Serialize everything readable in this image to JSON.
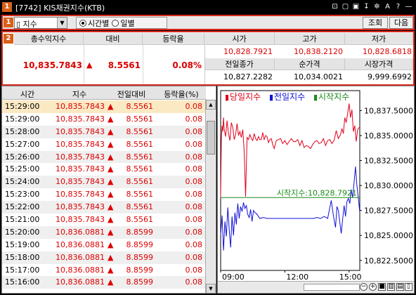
{
  "titlebar": {
    "badge": "1",
    "title": "[7742] KIS채권지수(KTB)",
    "controls": [
      "⊡",
      "▢",
      "▣",
      "↧",
      "✲",
      "A",
      "?",
      "—"
    ]
  },
  "toolbar": {
    "badge": "1",
    "select_value": "▯ 지수",
    "radio_time": "시간별",
    "radio_day": "일별",
    "query_button": "조회",
    "next_button": "다음"
  },
  "summary": {
    "badge": "2",
    "headers": {
      "total": "총수익지수",
      "change": "대비",
      "rate": "등락율",
      "high_open": "시가",
      "high": "고가",
      "low": "저가",
      "prev_close": "전일종가",
      "net_price": "순가격",
      "market_price": "시장가격"
    },
    "total_value": "10,835.7843",
    "change_arrow": "▲",
    "change_value": "8.5561",
    "rate_value": "0.08%",
    "open": "10,828.7921",
    "high": "10,838.2120",
    "low": "10,828.6818",
    "prev_close": "10,827.2282",
    "net_price": "10,034.0021",
    "market_price": "9,999.6992"
  },
  "table": {
    "columns": [
      "시간",
      "지수",
      "전일대비",
      "등락율(%)"
    ],
    "rows": [
      {
        "time": "15:29:00",
        "index": "10,835.7843",
        "arrow": "▲",
        "change": "8.5561",
        "rate": "0.08"
      },
      {
        "time": "15:29:00",
        "index": "10,835.7843",
        "arrow": "▲",
        "change": "8.5561",
        "rate": "0.08"
      },
      {
        "time": "15:28:00",
        "index": "10,835.7843",
        "arrow": "▲",
        "change": "8.5561",
        "rate": "0.08"
      },
      {
        "time": "15:27:00",
        "index": "10,835.7843",
        "arrow": "▲",
        "change": "8.5561",
        "rate": "0.08"
      },
      {
        "time": "15:26:00",
        "index": "10,835.7843",
        "arrow": "▲",
        "change": "8.5561",
        "rate": "0.08"
      },
      {
        "time": "15:25:00",
        "index": "10,835.7843",
        "arrow": "▲",
        "change": "8.5561",
        "rate": "0.08"
      },
      {
        "time": "15:24:00",
        "index": "10,835.7843",
        "arrow": "▲",
        "change": "8.5561",
        "rate": "0.08"
      },
      {
        "time": "15:23:00",
        "index": "10,835.7843",
        "arrow": "▲",
        "change": "8.5561",
        "rate": "0.08"
      },
      {
        "time": "15:22:00",
        "index": "10,835.7843",
        "arrow": "▲",
        "change": "8.5561",
        "rate": "0.08"
      },
      {
        "time": "15:21:00",
        "index": "10,835.7843",
        "arrow": "▲",
        "change": "8.5561",
        "rate": "0.08"
      },
      {
        "time": "15:20:00",
        "index": "10,836.0881",
        "arrow": "▲",
        "change": "8.8599",
        "rate": "0.08"
      },
      {
        "time": "15:19:00",
        "index": "10,836.0881",
        "arrow": "▲",
        "change": "8.8599",
        "rate": "0.08"
      },
      {
        "time": "15:18:00",
        "index": "10,836.0881",
        "arrow": "▲",
        "change": "8.8599",
        "rate": "0.08"
      },
      {
        "time": "15:17:00",
        "index": "10,836.0881",
        "arrow": "▲",
        "change": "8.8599",
        "rate": "0.08"
      },
      {
        "time": "15:16:00",
        "index": "10,836.0881",
        "arrow": "▲",
        "change": "8.8599",
        "rate": "0.08"
      }
    ]
  },
  "chart_data": {
    "type": "line",
    "title": "",
    "legend": [
      {
        "name": "당일지수",
        "marker": "▮",
        "color": "#e0001a"
      },
      {
        "name": "전일지수",
        "marker": "▮",
        "color": "#1010d8"
      },
      {
        "name": "시작지수",
        "marker": "▮",
        "color": "#1a8a1a"
      }
    ],
    "legend_placement": "top-left",
    "xlabel": "",
    "ylabel": "",
    "x_ticks": [
      "09:00",
      "12:00",
      "15:00"
    ],
    "y_ticks": [
      10822.5,
      10825.0,
      10827.5,
      10830.0,
      10832.5,
      10835.0,
      10837.5
    ],
    "y_tick_labels": [
      "10,822.5000",
      "10,825.0000",
      "10,827.5000",
      "10,830.0000",
      "10,832.5000",
      "10,835.0000",
      "10,837.5000"
    ],
    "ylim": [
      10821.5,
      10839.5
    ],
    "xlim": [
      0,
      390
    ],
    "start_label": "시작지수:10,828.7921",
    "start_value": 10828.7921,
    "series": [
      {
        "name": "당일지수",
        "color": "#e0001a",
        "x": [
          0,
          2,
          4,
          6,
          8,
          10,
          14,
          18,
          22,
          26,
          30,
          34,
          38,
          42,
          46,
          50,
          54,
          58,
          62,
          66,
          70,
          74,
          78,
          82,
          86,
          90,
          94,
          98,
          102,
          106,
          110,
          114,
          118,
          122,
          126,
          130,
          134,
          138,
          142,
          146,
          150,
          156,
          162,
          168,
          174,
          180,
          186,
          192,
          198,
          204,
          210,
          216,
          222,
          228,
          234,
          240,
          246,
          252,
          258,
          264,
          270,
          276,
          282,
          288,
          294,
          300,
          306,
          312,
          318,
          324,
          330,
          336,
          340,
          344,
          348,
          352,
          356,
          360,
          364,
          368,
          372,
          376,
          380,
          384,
          388,
          390
        ],
        "y": [
          10828.8,
          10834.6,
          10836.0,
          10835.4,
          10836.8,
          10835.6,
          10834.9,
          10836.5,
          10835.2,
          10834.5,
          10836.3,
          10835.8,
          10834.6,
          10835.1,
          10836.2,
          10835.0,
          10835.4,
          10834.8,
          10835.6,
          10833.4,
          10828.9,
          10834.8,
          10834.6,
          10835.1,
          10834.7,
          10834.5,
          10835.2,
          10834.7,
          10834.5,
          10834.9,
          10834.6,
          10834.6,
          10835.3,
          10834.6,
          10835.0,
          10834.9,
          10834.3,
          10834.6,
          10834.7,
          10834.1,
          10833.7,
          10834.5,
          10834.6,
          10834.7,
          10834.2,
          10834.5,
          10834.1,
          10834.4,
          10834.7,
          10834.4,
          10834.4,
          10834.6,
          10834.0,
          10834.5,
          10833.8,
          10834.0,
          10833.9,
          10833.7,
          10834.1,
          10834.4,
          10834.5,
          10834.2,
          10834.3,
          10834.7,
          10834.0,
          10834.5,
          10834.6,
          10834.2,
          10834.5,
          10835.5,
          10834.7,
          10835.1,
          10835.7,
          10835.2,
          10836.8,
          10836.3,
          10837.2,
          10838.2,
          10836.8,
          10837.6,
          10835.4,
          10836.0,
          10834.4,
          10835.6,
          10835.8,
          10835.8
        ]
      },
      {
        "name": "전일지수",
        "color": "#1010d8",
        "x": [
          0,
          4,
          8,
          12,
          16,
          20,
          24,
          28,
          32,
          36,
          40,
          44,
          48,
          52,
          56,
          60,
          64,
          68,
          72,
          76,
          80,
          84,
          88,
          92,
          96,
          100,
          110,
          120,
          130,
          140,
          150,
          160,
          170,
          180,
          190,
          200,
          210,
          220,
          230,
          240,
          250,
          260,
          270,
          280,
          290,
          300,
          310,
          316,
          322,
          326,
          330,
          334,
          338,
          342,
          346,
          350,
          354,
          358,
          362,
          366,
          370,
          374,
          378,
          382,
          386,
          390
        ],
        "y": [
          10825.1,
          10827.0,
          10823.5,
          10826.4,
          10824.9,
          10827.8,
          10825.6,
          10823.8,
          10826.9,
          10825.0,
          10827.3,
          10826.1,
          10828.2,
          10826.7,
          10827.9,
          10827.4,
          10828.3,
          10827.7,
          10828.0,
          10827.1,
          10826.8,
          10827.6,
          10826.4,
          10827.5,
          10827.3,
          10827.2,
          10826.7,
          10826.8,
          10826.7,
          10826.7,
          10826.7,
          10826.7,
          10826.7,
          10826.7,
          10826.7,
          10826.7,
          10826.7,
          10826.7,
          10826.7,
          10826.7,
          10826.7,
          10826.7,
          10826.8,
          10826.7,
          10826.9,
          10826.7,
          10828.5,
          10827.0,
          10825.8,
          10827.9,
          10827.5,
          10826.3,
          10825.2,
          10826.6,
          10828.0,
          10826.9,
          10828.4,
          10828.7,
          10828.2,
          10829.6,
          10828.8,
          10830.3,
          10831.9,
          10830.0,
          10828.7,
          10827.3
        ]
      },
      {
        "name": "시작지수",
        "color": "#1a8a1a",
        "x": [
          0,
          390
        ],
        "y": [
          10828.7921,
          10828.7921
        ]
      }
    ]
  }
}
